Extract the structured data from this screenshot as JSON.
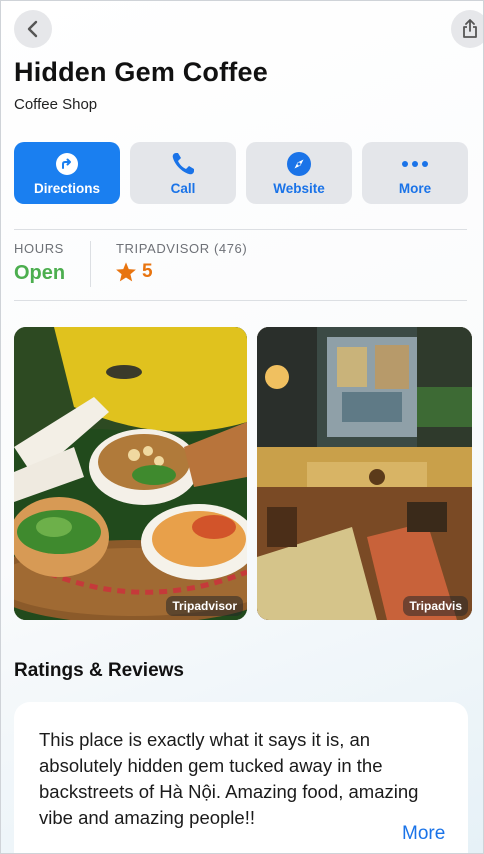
{
  "header": {
    "back_icon": "chevron-left-icon",
    "share_icon": "share-icon"
  },
  "place": {
    "name": "Hidden Gem Coffee",
    "category": "Coffee Shop"
  },
  "actions": [
    {
      "label": "Directions",
      "icon": "directions-arrow-icon",
      "primary": true
    },
    {
      "label": "Call",
      "icon": "phone-icon",
      "primary": false
    },
    {
      "label": "Website",
      "icon": "compass-icon",
      "primary": false
    },
    {
      "label": "More",
      "icon": "ellipsis-icon",
      "primary": false
    }
  ],
  "info": {
    "hours_label": "HOURS",
    "hours_value": "Open",
    "tripadvisor_label": "TRIPADVISOR (476)",
    "rating_value": "5"
  },
  "photos": [
    {
      "description_icon": "food-photo",
      "credit": "Tripadvisor"
    },
    {
      "description_icon": "cafe-interior-photo",
      "credit": "Tripadvis"
    }
  ],
  "reviews": {
    "section_title": "Ratings & Reviews",
    "text": "This place is exactly what it says it is, an absolutely hidden gem tucked away in the backstreets of Hà Nội. Amazing food, amazing vibe and amazing people!!",
    "more_label": "More"
  },
  "colors": {
    "accent": "#1a7ff0",
    "link": "#1a73e8",
    "open": "#4cae4f",
    "rating": "#e8740f"
  }
}
